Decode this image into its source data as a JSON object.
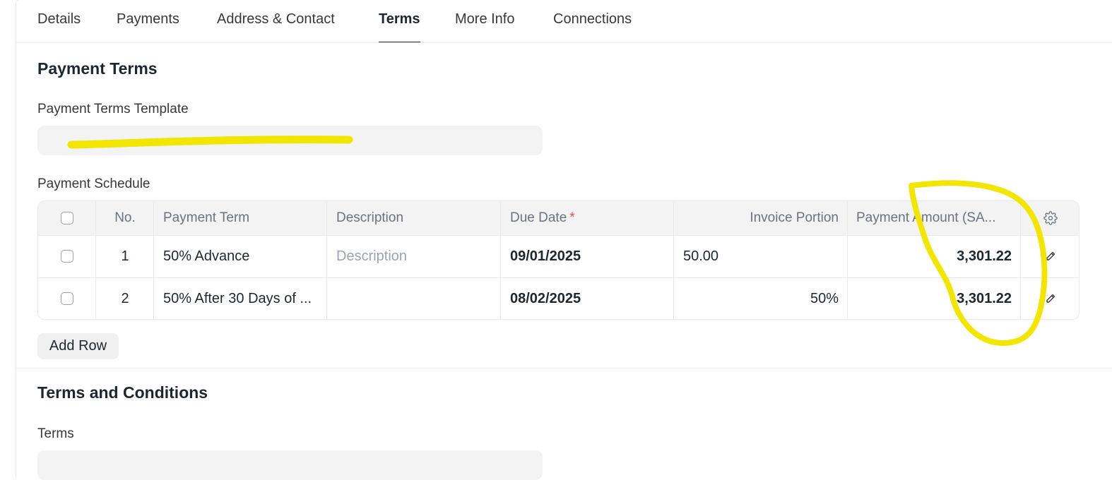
{
  "tabs": [
    {
      "label": "Details",
      "active": false
    },
    {
      "label": "Payments",
      "active": false
    },
    {
      "label": "Address & Contact",
      "active": false
    },
    {
      "label": "Terms",
      "active": true
    },
    {
      "label": "More Info",
      "active": false
    },
    {
      "label": "Connections",
      "active": false
    }
  ],
  "payment_terms": {
    "section_title": "Payment Terms",
    "template_label": "Payment Terms Template",
    "template_value": "",
    "schedule_label": "Payment Schedule",
    "columns": {
      "no": "No.",
      "payment_term": "Payment Term",
      "description": "Description",
      "due_date": "Due Date",
      "due_date_required": "*",
      "invoice_portion": "Invoice Portion",
      "payment_amount": "Payment Amount (SA..."
    },
    "rows": [
      {
        "no": "1",
        "payment_term": "50% Advance",
        "description": "",
        "description_placeholder": "Description",
        "due_date": "09/01/2025",
        "invoice_portion": "50.00",
        "payment_amount": "3,301.22"
      },
      {
        "no": "2",
        "payment_term": "50% After 30 Days of ...",
        "description": "",
        "due_date": "08/02/2025",
        "invoice_portion": "50%",
        "payment_amount": "3,301.22"
      }
    ],
    "add_row_label": "Add Row"
  },
  "terms_conditions": {
    "section_title": "Terms and Conditions",
    "terms_label": "Terms",
    "terms_value": ""
  },
  "icons": {
    "settings": "gear-icon",
    "edit": "pencil-icon"
  },
  "colors": {
    "highlight_marker": "#f2e600",
    "required_asterisk": "#e24c4c",
    "field_background": "#f3f3f3"
  }
}
